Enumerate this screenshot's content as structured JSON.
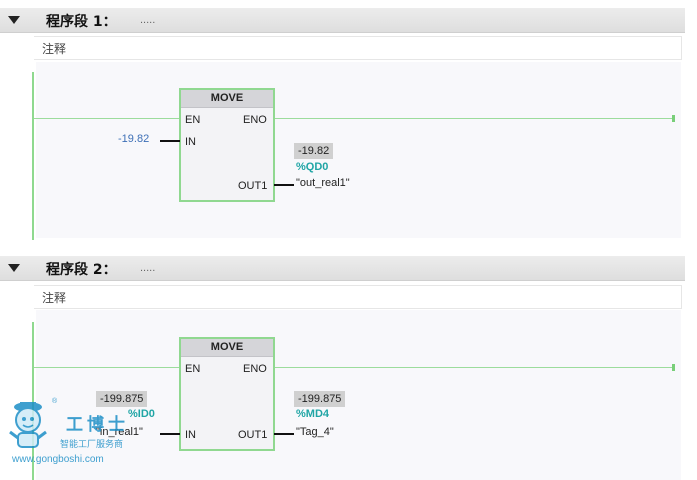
{
  "networks": [
    {
      "title": "程序段 1：",
      "dots": ".....",
      "comment": "注释",
      "block": {
        "name": "MOVE",
        "pin_en": "EN",
        "pin_eno": "ENO",
        "pin_in": "IN",
        "pin_out1": "OUT1",
        "in_value": "-19.82",
        "out_value": "-19.82",
        "out_address": "%QD0",
        "out_tag": "\"out_real1\""
      }
    },
    {
      "title": "程序段 2：",
      "dots": ".....",
      "comment": "注释",
      "block": {
        "name": "MOVE",
        "pin_en": "EN",
        "pin_eno": "ENO",
        "pin_in": "IN",
        "pin_out1": "OUT1",
        "in_value": "-199.875",
        "in_address": "%ID0",
        "in_tag": "\"in_real1\"",
        "out_value": "-199.875",
        "out_address": "%MD4",
        "out_tag": "\"Tag_4\""
      }
    }
  ],
  "watermark": {
    "name": "工博士",
    "subtitle": "智能工厂服务商",
    "url": "www.gongboshi.com",
    "registered": "®"
  },
  "colors": {
    "rung": "#9cdc9c",
    "block_border": "#90d890",
    "input_value": "#3d6fb6",
    "address": "#20a5a5",
    "watermark": "#1d8fc7"
  }
}
